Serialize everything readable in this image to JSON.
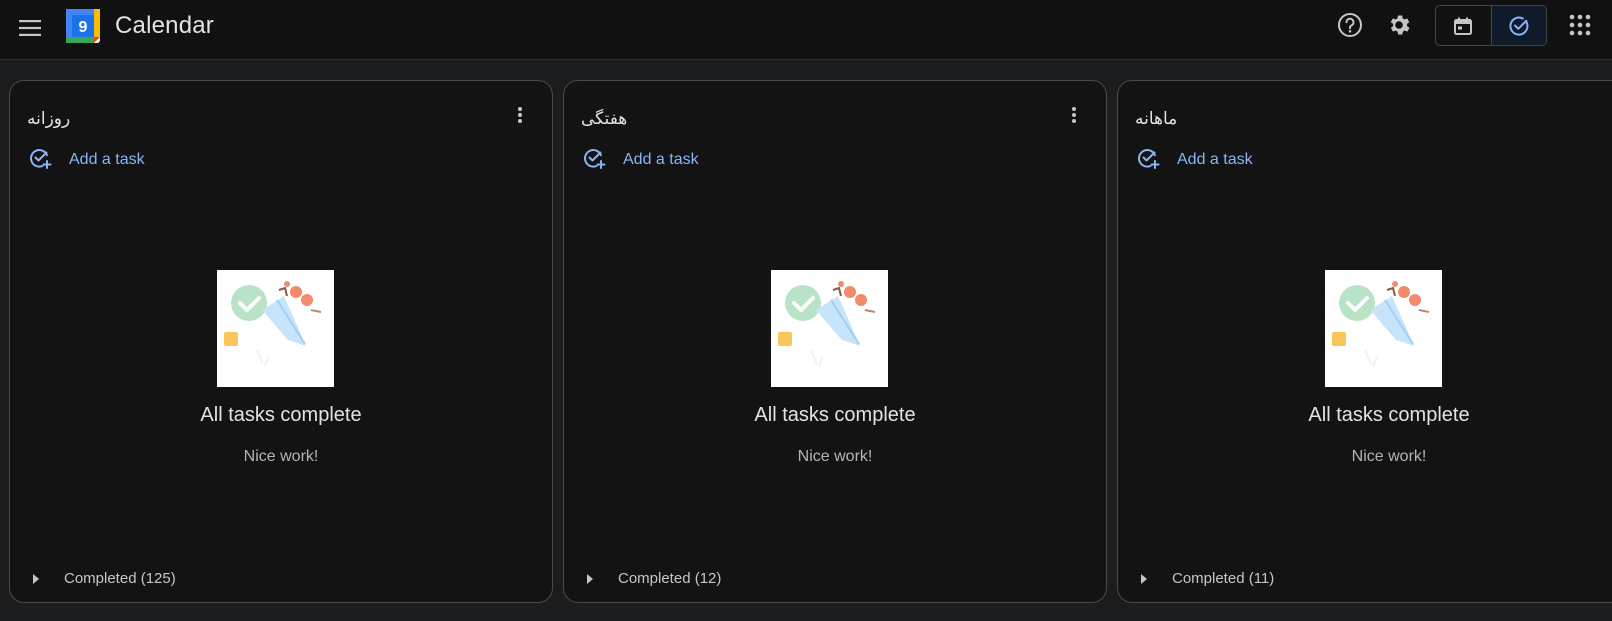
{
  "header": {
    "app_title": "Calendar",
    "logo_day": "9",
    "icons": [
      "menu-icon",
      "help-icon",
      "settings-icon",
      "calendar-icon",
      "tasks-icon",
      "apps-icon"
    ],
    "active_view": "tasks"
  },
  "colors": {
    "accent": "#8ab4f8",
    "background": "#1b1c1e",
    "card": "#131313"
  },
  "lists": [
    {
      "title": "روزانه",
      "add_task_label": "Add a task",
      "empty_title": "All tasks complete",
      "empty_subtitle": "Nice work!",
      "completed_label": "Completed (125)"
    },
    {
      "title": "هفتگی",
      "add_task_label": "Add a task",
      "empty_title": "All tasks complete",
      "empty_subtitle": "Nice work!",
      "completed_label": "Completed (12)"
    },
    {
      "title": "ماهانه",
      "add_task_label": "Add a task",
      "empty_title": "All tasks complete",
      "empty_subtitle": "Nice work!",
      "completed_label": "Completed (11)"
    }
  ]
}
